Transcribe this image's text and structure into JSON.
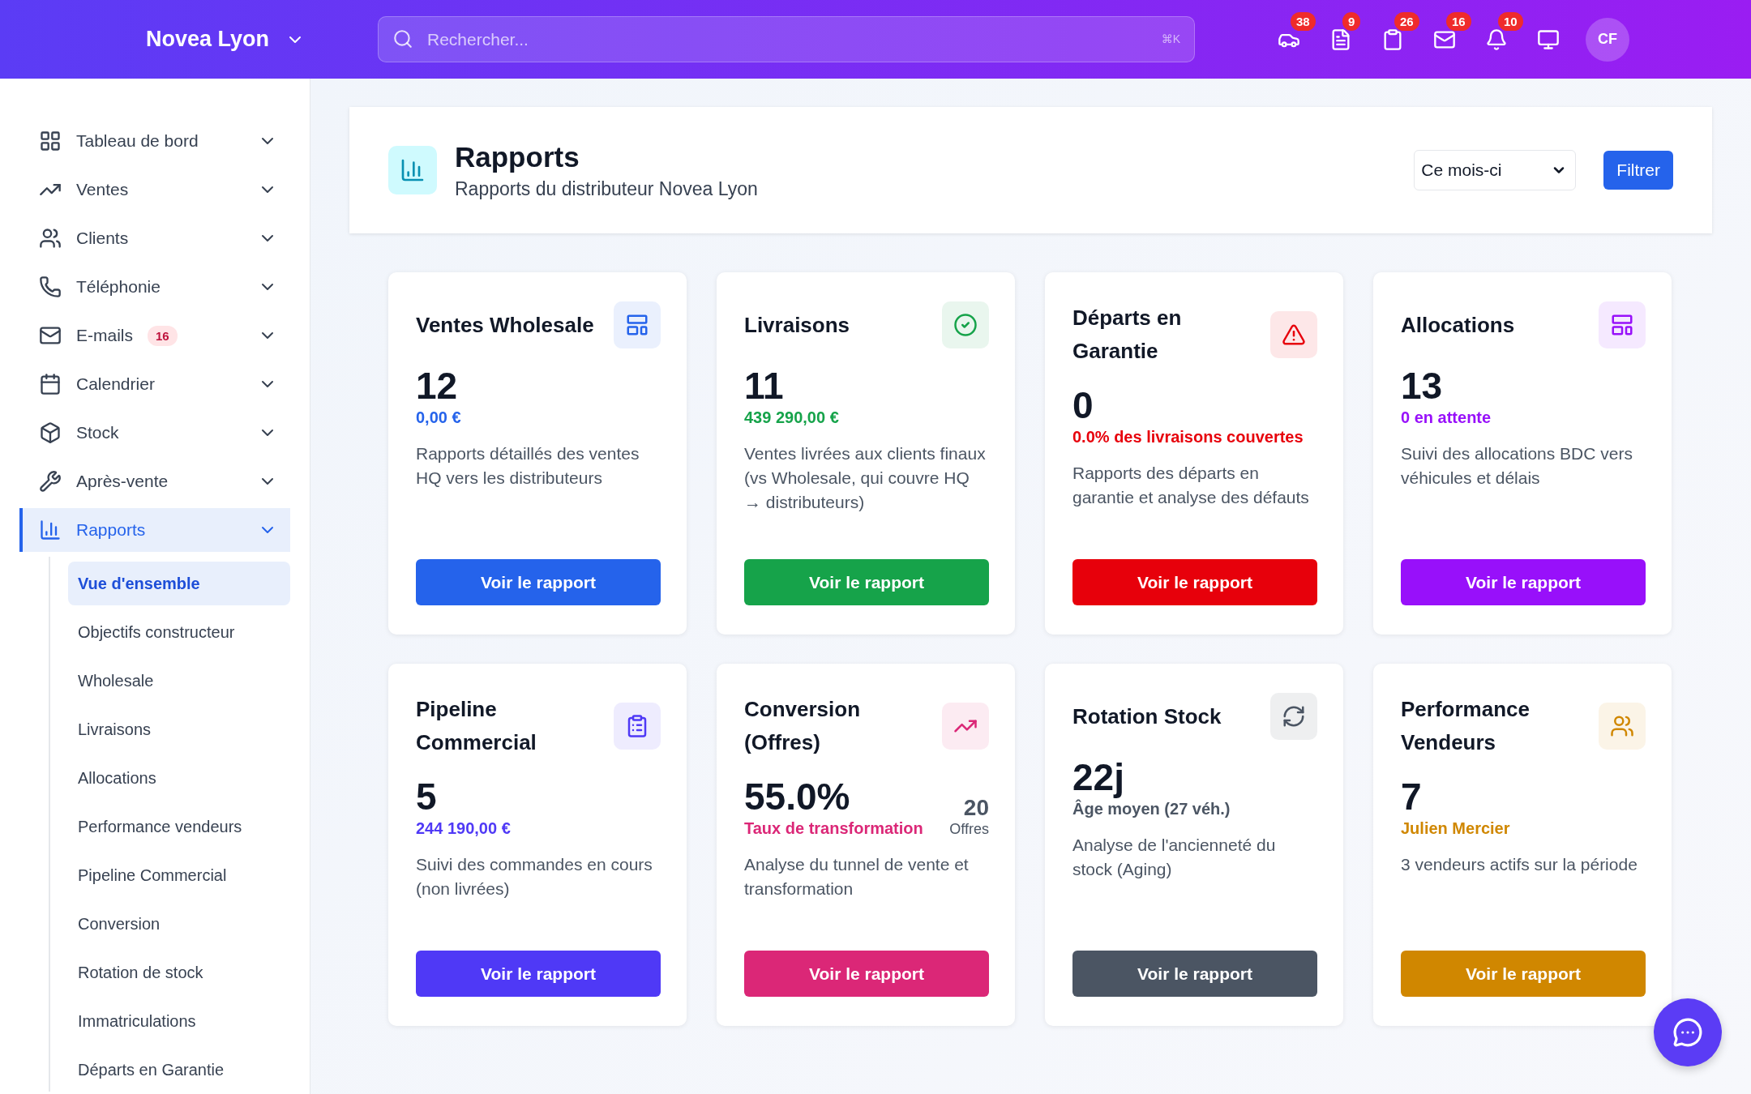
{
  "header": {
    "brand": "Novea Lyon",
    "search": {
      "placeholder": "Rechercher...",
      "shortcut": "⌘K"
    },
    "notifications": [
      {
        "count": "38"
      },
      {
        "count": "9"
      },
      {
        "count": "26"
      },
      {
        "count": "16"
      },
      {
        "count": "10"
      }
    ],
    "avatar": "CF"
  },
  "sidebar": {
    "items": [
      {
        "label": "Tableau de bord",
        "selected": false
      },
      {
        "label": "Ventes",
        "selected": false
      },
      {
        "label": "Clients",
        "selected": false
      },
      {
        "label": "Téléphonie",
        "selected": false
      },
      {
        "label": "E-mails",
        "badge": "16",
        "selected": false
      },
      {
        "label": "Calendrier",
        "selected": false
      },
      {
        "label": "Stock",
        "selected": false
      },
      {
        "label": "Après-vente",
        "selected": false
      },
      {
        "label": "Rapports",
        "selected": true,
        "children": [
          {
            "label": "Vue d'ensemble",
            "selected": true
          },
          {
            "label": "Objectifs constructeur",
            "selected": false
          },
          {
            "label": "Wholesale",
            "selected": false
          },
          {
            "label": "Livraisons",
            "selected": false
          },
          {
            "label": "Allocations",
            "selected": false
          },
          {
            "label": "Performance vendeurs",
            "selected": false
          },
          {
            "label": "Pipeline Commercial",
            "selected": false
          },
          {
            "label": "Conversion",
            "selected": false
          },
          {
            "label": "Rotation de stock",
            "selected": false
          },
          {
            "label": "Immatriculations",
            "selected": false
          },
          {
            "label": "Départs en Garantie",
            "selected": false
          }
        ]
      }
    ]
  },
  "page": {
    "title": "Rapports",
    "subtitle": "Rapports du distributeur Novea Lyon",
    "period": "Ce mois-ci",
    "filter_button": "Filtrer"
  },
  "cards": [
    {
      "title": "Ventes Wholesale",
      "value": "12",
      "subtitle": "0,00 €",
      "description": "Rapports détaillés des ventes HQ vers les distributeurs",
      "button": "Voir le rapport",
      "color": "#2563eb"
    },
    {
      "title": "Livraisons",
      "value": "11",
      "subtitle": "439 290,00 €",
      "description": "Ventes livrées aux clients finaux (vs Wholesale, qui couvre HQ → distributeurs)",
      "button": "Voir le rapport",
      "color": "#16a34a"
    },
    {
      "title": "Départs en Garantie",
      "value": "0",
      "subtitle": "0.0% des livraisons couvertes",
      "description": "Rapports des départs en garantie et analyse des défauts",
      "button": "Voir le rapport",
      "color": "#e7000b"
    },
    {
      "title": "Allocations",
      "value": "13",
      "subtitle": "0 en attente",
      "description": "Suivi des allocations BDC vers véhicules et délais",
      "button": "Voir le rapport",
      "color": "#9810fa"
    },
    {
      "title": "Pipeline Commercial",
      "value": "5",
      "subtitle": "244 190,00 €",
      "description": "Suivi des commandes en cours (non livrées)",
      "button": "Voir le rapport",
      "color": "#4f39f6"
    },
    {
      "title": "Conversion (Offres)",
      "value": "55.0%",
      "subtitle": "Taux de transformation",
      "side": {
        "value": "20",
        "label": "Offres"
      },
      "description": "Analyse du tunnel de vente et transformation",
      "button": "Voir le rapport",
      "color": "#db2777"
    },
    {
      "title": "Rotation Stock",
      "value": "22j",
      "subtitle": "Âge moyen (27 véh.)",
      "description": "Analyse de l'ancienneté du stock (Aging)",
      "button": "Voir le rapport",
      "color": "#4b5563"
    },
    {
      "title": "Performance Vendeurs",
      "value": "7",
      "subtitle": "Julien Mercier",
      "description": "3 vendeurs actifs sur la période",
      "button": "Voir le rapport",
      "color": "#d08700"
    }
  ]
}
